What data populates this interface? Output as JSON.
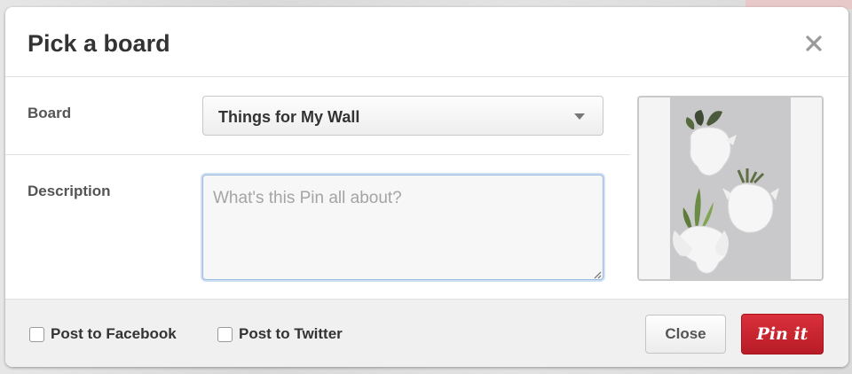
{
  "dialog": {
    "title": "Pick a board"
  },
  "board": {
    "label": "Board",
    "selected": "Things for My Wall"
  },
  "description": {
    "label": "Description",
    "placeholder": "What's this Pin all about?",
    "value": ""
  },
  "pin_image": {
    "subject": "three white ceramic animal-head planters with succulents on a grey wall"
  },
  "footer": {
    "facebook_label": "Post to Facebook",
    "twitter_label": "Post to Twitter",
    "close_label": "Close",
    "pin_label": "Pin it"
  },
  "colors": {
    "accent": "#cb2027",
    "focus": "#99b9de"
  },
  "icons": {
    "close": "close-icon",
    "dropdown": "chevron-down-icon",
    "resize": "resize-grip-icon"
  }
}
